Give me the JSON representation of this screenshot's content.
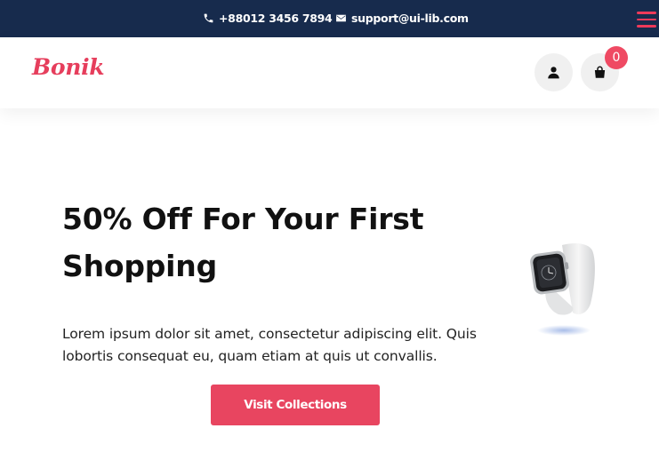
{
  "topbar": {
    "phone": "+88012 3456 7894",
    "email": "support@ui-lib.com",
    "phone_icon": "phone-icon",
    "email_icon": "envelope-icon",
    "menu_icon": "hamburger-menu-icon"
  },
  "header": {
    "logo": "Bonik",
    "user_icon": "user-icon",
    "cart_icon": "shopping-bag-icon",
    "cart_count": "0"
  },
  "hero": {
    "title": "50% Off For Your First Shopping",
    "text": "Lorem ipsum dolor sit amet, consectetur adipiscing elit. Quis lobortis consequat eu, quam etiam at quis ut convallis.",
    "cta_label": "Visit Collections",
    "product_image": "smartwatch-image"
  },
  "colors": {
    "topbar_bg": "#172b4d",
    "brand": "#e63e5c",
    "button": "#e84560",
    "badge": "#ef4a63"
  }
}
